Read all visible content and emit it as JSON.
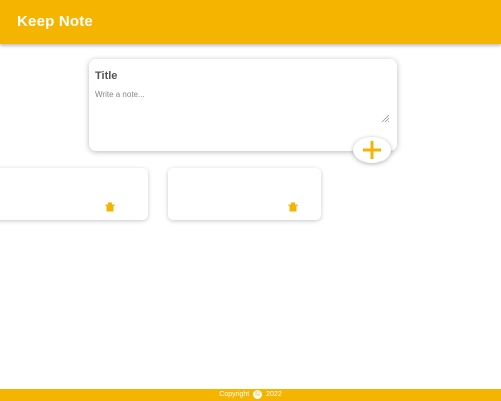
{
  "header": {
    "app_title": "Keep Note"
  },
  "create_area": {
    "title_placeholder": "Title",
    "content_placeholder": "Write a note...",
    "add_button_icon": "plus-icon"
  },
  "notes": [
    {
      "title": "",
      "content": "",
      "delete_icon": "delete-icon"
    },
    {
      "title": "",
      "content": "",
      "delete_icon": "delete-icon"
    }
  ],
  "footer": {
    "copyright_label": "Copyright",
    "copyright_symbol": "©",
    "year": "2022"
  },
  "colors": {
    "accent": "#f5b400",
    "background": "#ffffff",
    "header_text": "#ffffff",
    "note_title_text": "#555555"
  }
}
